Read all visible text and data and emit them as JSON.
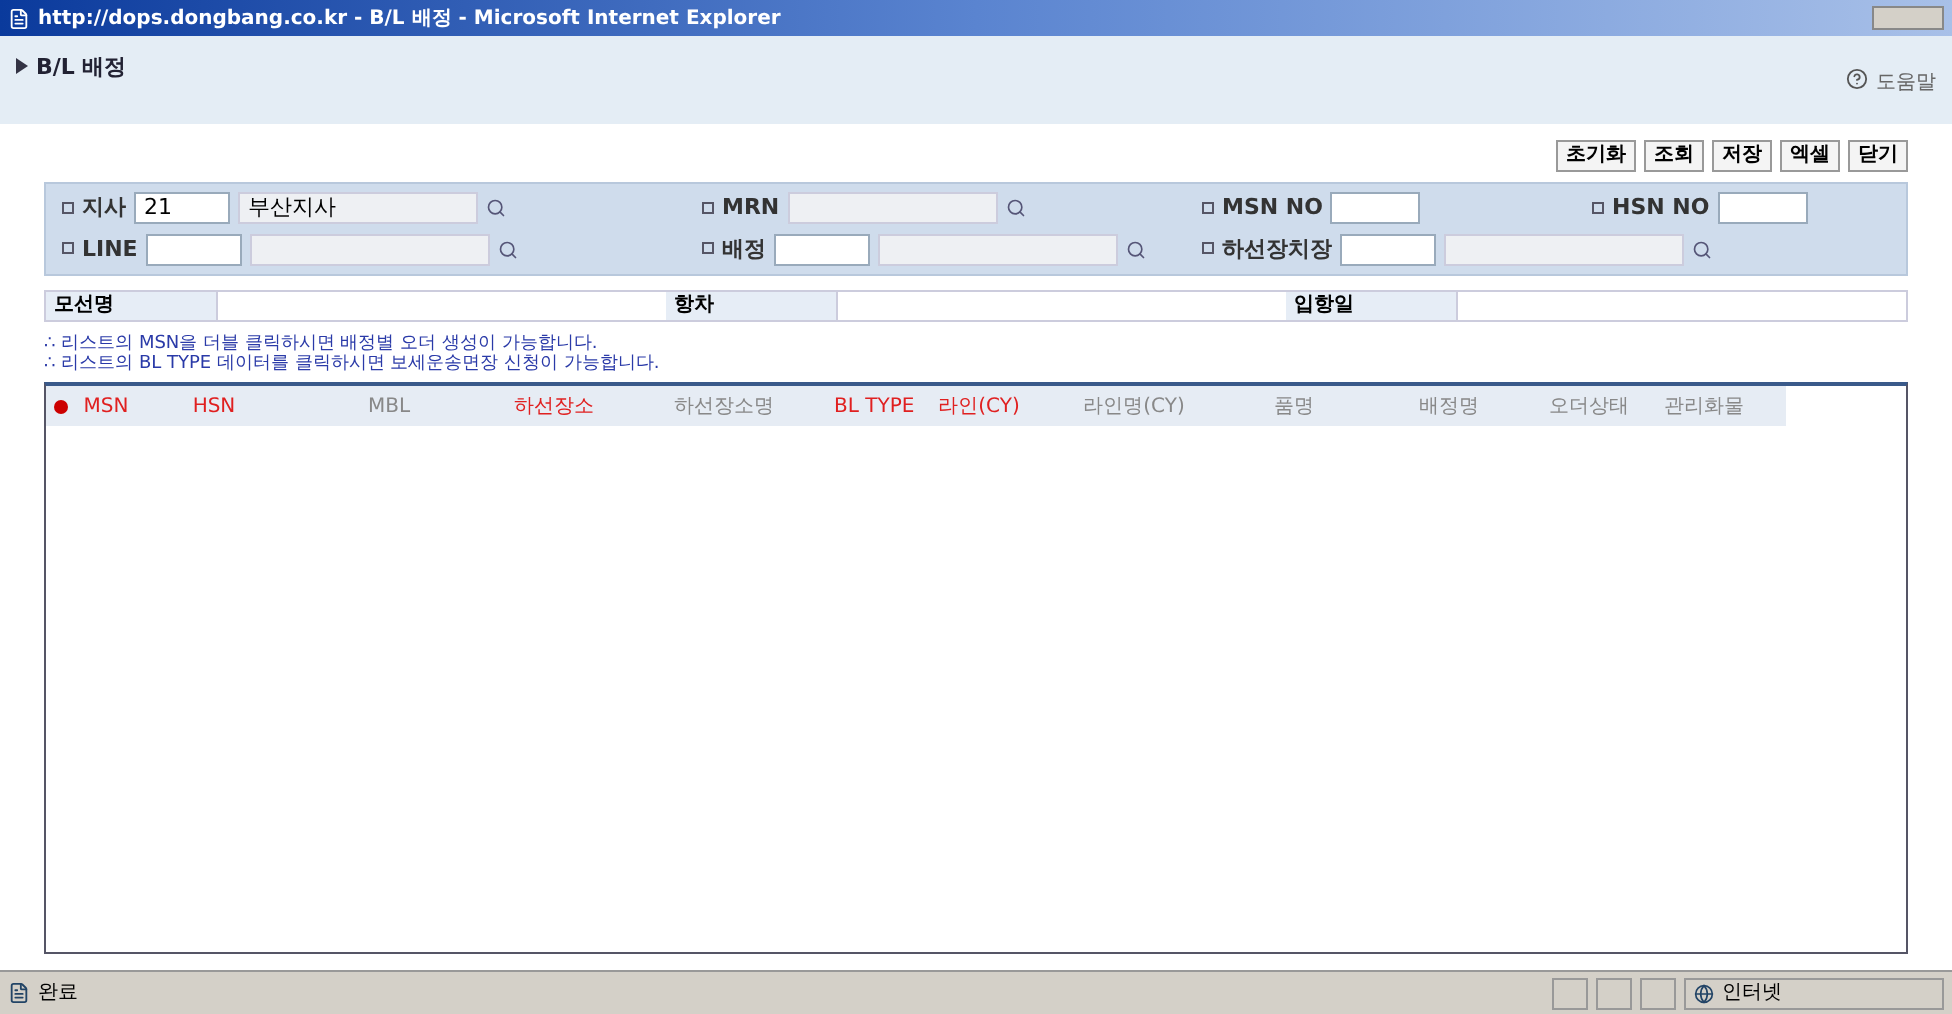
{
  "window": {
    "title": "http://dops.dongbang.co.kr - B/L 배정 - Microsoft Internet Explorer"
  },
  "page": {
    "title": "B/L 배정",
    "help": "도움말"
  },
  "toolbar": [
    "초기화",
    "조회",
    "저장",
    "엑셀",
    "닫기"
  ],
  "filters": {
    "row1": [
      {
        "label": "지사",
        "code": "21",
        "name": "부산지사",
        "kind": "lookup"
      },
      {
        "label": "MRN",
        "kind": "lookup-wide"
      },
      {
        "label": "MSN NO",
        "kind": "short"
      },
      {
        "label": "HSN NO",
        "kind": "short"
      }
    ],
    "row2": [
      {
        "label": "LINE",
        "kind": "lookup"
      },
      {
        "label": "배정",
        "kind": "lookup"
      },
      {
        "label": "하선장치장",
        "kind": "lookup"
      }
    ]
  },
  "vessel": {
    "fields": [
      "모선명",
      "항차",
      "입항일"
    ]
  },
  "notes": [
    "∴ 리스트의 MSN을 더블 클릭하시면 배정별 오더 생성이 가능합니다.",
    "∴ 리스트의 BL TYPE 데이터를 클릭하시면 보세운송면장 신청이 가능합니다."
  ],
  "grid": {
    "columns": [
      {
        "label": "MSN",
        "highlight": true
      },
      {
        "label": "HSN",
        "highlight": true
      },
      {
        "label": "MBL",
        "highlight": false
      },
      {
        "label": "하선장소",
        "highlight": true
      },
      {
        "label": "하선장소명",
        "highlight": false
      },
      {
        "label": "BL TYPE",
        "highlight": true
      },
      {
        "label": "라인(CY)",
        "highlight": true
      },
      {
        "label": "라인명(CY)",
        "highlight": false
      },
      {
        "label": "품명",
        "highlight": false
      },
      {
        "label": "배정명",
        "highlight": false
      },
      {
        "label": "오더상태",
        "highlight": false
      },
      {
        "label": "관리화물",
        "highlight": false
      }
    ]
  },
  "status_bar": {
    "text": "완료",
    "zone": "인터넷"
  }
}
